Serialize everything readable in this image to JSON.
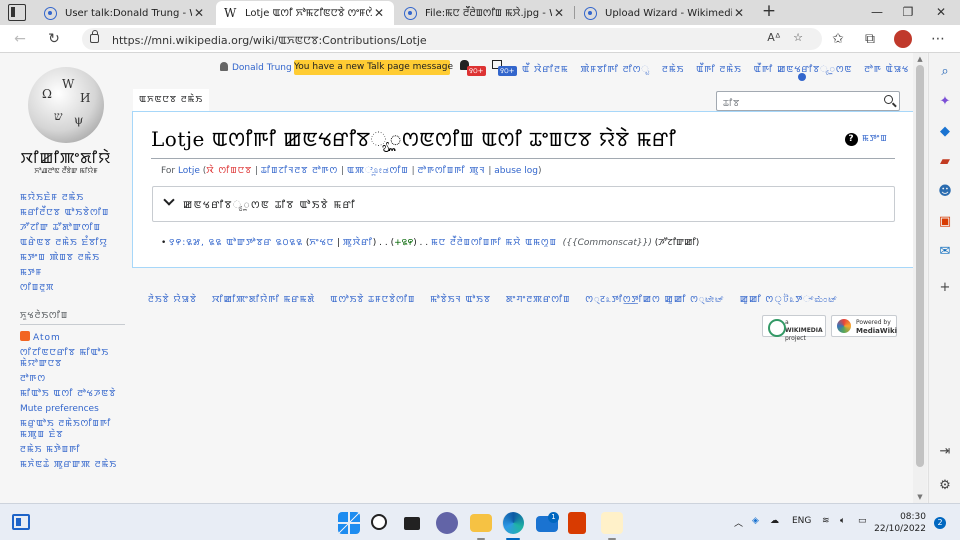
{
  "browser": {
    "tabs": [
      {
        "title": "User talk:Donald Trung - Wikimedia"
      },
      {
        "title": "Lotje ꯑꯁꯤ ꯈꯣꯃꯖꯤꯟꯅꯕꯥ ꯁꯦꯝꯁꯥꯅ"
      },
      {
        "title": "File:ꯃꯅ ꯂꯩꯂꯥꯡꯁꯤꯡ ꯃꯆꯥ.jpg - W"
      },
      {
        "title": "Upload Wizard - Wikimedia Commons"
      }
    ],
    "url": "https://mni.wikipedia.org/wiki/ꯑꯈꯟꯅꯕ:Contributions/Lotje"
  },
  "site": {
    "wordmark": "ꯋꯤꯀꯤꯄꯦꯗꯤꯌꯥ",
    "tagline": "ꯈꯣꯉꯂꯣꯟ ꯂꯩꯕꯥꯛ ꯃꯤꯌꯥꯝ"
  },
  "sidebar": {
    "nav": [
      "ꯃꯌꯥꯏꯐꯥꯝ ꯂꯃꯥꯏ",
      "ꯃꯔꯤꯂꯩꯅꯕ ꯑꯣꯏꯕꯥꯁꯤꯡ",
      "ꯍꯧꯖꯤꯛ ꯊꯧꯗꯣꯛꯁꯤꯡ",
      "ꯑꯔꯥꯟꯕ ꯂꯃꯥꯏ ꯐꯪꯕꯤꯌꯨ",
      "ꯃꯇꯦꯡ ꯄꯥꯡꯕ ꯂꯃꯥꯏ",
      "ꯃꯇꯝ",
      "ꯁꯤꯡꯂꯨꯞ"
    ],
    "tools_heading": "ꯈꯨꯠꯂꯥꯏꯁꯤꯡ",
    "tools": [
      "Atom",
      "ꯁꯤꯖꯤꯟꯅꯔꯤꯕ ꯃꯤꯑꯣꯏ ꯃꯥꯌꯣꯛꯅꯕ",
      "ꯂꯣꯒꯁ",
      "ꯃꯤꯑꯣꯏ ꯑꯁꯤ ꯂꯣꯠꯍꯟꯕꯥ",
      "Mute preferences",
      "ꯃꯔꯨꯑꯣꯏ ꯂꯃꯥꯏꯁꯤꯡꯒꯤ ꯃꯄꯨꯡ ꯐꯥꯕ",
      "ꯂꯃꯥꯏ ꯃꯇꯥꯡꯒꯤ",
      "ꯃꯈꯥꯟꯊꯥ ꯄꯨꯔꯛꯄ ꯂꯃꯥꯏ"
    ]
  },
  "usertools": {
    "username": "Donald Trung",
    "talk_notice": "You have a new Talk page message",
    "alerts_badge": "꯱꯰+",
    "notices_badge": "꯱꯰+",
    "links": [
      "ꯑꯩ ꯋꯥꯔꯤꯂꯃ",
      "ꯄꯥꯝꯕꯤꯒꯤ ꯂꯤꯁ್ಟ",
      "ꯂꯃꯥꯏ",
      "ꯑꯩꯒꯤ ꯂꯃꯥꯏ",
      "ꯑꯩꯒꯤ ꯀꯟꯠꯔꯤꯕ್ಯꯨꯁꯟ",
      "ꯂꯣꯒ ꯑꯥꯎꯠ"
    ]
  },
  "content_tab": "ꯑꯈꯟꯅꯕ ꯂꯃꯥꯏ",
  "search": {
    "placeholder": "ꯊꯤꯕ"
  },
  "page": {
    "title": "Lotje ꯑꯁꯤꯒꯤ ꯀꯟꯠꯔꯤꯕ್ಯꯨꯁꯟꯁꯤꯡ ꯑꯁꯤ ꯊꯦꯡꯅꯕ ꯌꯥꯕꯥ ꯃꯔꯤ",
    "help": "ꯃꯇꯦꯡ",
    "for_prefix": "For",
    "user": "Lotje",
    "sub_links": [
      "ꯋꯥ ꯁꯤꯡꯅꯕ",
      "ꯊꯤꯡꯖꯤꯜꯂꯕ ꯂꯣꯒꯁ",
      "ꯑꯄ್ಲೋಡꯁꯤꯡ",
      "ꯂꯣꯒꯁꯤꯡꯒꯤ ꯄꯨꯜ",
      "abuse log"
    ],
    "search_box_label": "ꯀꯟꯠꯔꯤꯕ್ಯꯨꯁꯟ ꯊꯤꯕ ꯑꯣꯏꯕꯥ ꯃꯔꯤ",
    "contribution": {
      "time": "꯱꯵:꯲꯷, ꯲꯲ ꯑꯣꯛꯇꯣꯕꯔ ꯲꯰꯲꯲",
      "diff": "ꯈꯦꯠꯅ",
      "hist": "ꯄꯨꯋꯥꯔꯤ",
      "size_change": "+꯲꯵",
      "page": "ꯃꯅ ꯂꯩꯂꯥꯡꯁꯤꯡꯒꯤ ꯃꯆꯥ ꯑꯃꯁꯨꯡ",
      "comment": "{{Commonscat}}",
      "current": "ꯍꯧꯖꯤꯛꯀꯤ"
    }
  },
  "footer": {
    "links": [
      "ꯂꯥꯏꯕꯥ ꯌꯥꯎꯕꯥ",
      "ꯋꯤꯀꯤꯄꯦꯗꯤꯌꯥꯒꯤ ꯃꯔꯃꯗꯥ",
      "ꯑꯁꯣꯏꯕꯥ ꯊꯝꯅꯕꯥꯁꯤꯡ",
      "ꯃꯣꯕꯥꯏꯜ ꯑꯣꯏꯕ",
      "ꯗꯦꯚꯦꯂꯄꯔꯁꯤꯡ",
      "ꯁ्ट೩ꯇꯤꯁ꯭ꯇꯤꯀꯁ ꯀꯨꯀꯤ ꯁ्ಟೇಟ್",
      "ꯀꯨꯀꯤ ꯁ্ট೩ꯇ್‌ಮೆಂಟ್"
    ],
    "wikimedia_badge": [
      "a",
      "WIKIMEDIA",
      "project"
    ],
    "mediawiki_badge": [
      "Powered by",
      "MediaWiki"
    ]
  },
  "taskbar": {
    "lang": "ENG",
    "time": "08:30",
    "date": "22/10/2022",
    "notifications": "2",
    "mail_badge": "1"
  }
}
